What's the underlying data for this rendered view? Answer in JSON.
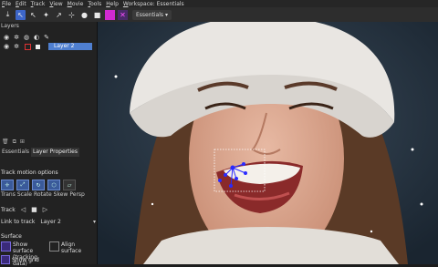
{
  "menu": [
    "File",
    "Edit",
    "Track",
    "View",
    "Movie",
    "Tools",
    "Help",
    "Workspace: Essentials"
  ],
  "toolbar": {
    "icons": [
      "save-icon",
      "arrow-icon",
      "select-icon",
      "wand-icon",
      "pointer-icon",
      "transform-icon",
      "circle-icon",
      "square-icon",
      "magenta-square-icon",
      "mask-x-icon"
    ],
    "workspace": "Essentials"
  },
  "layers": {
    "title": "Layers",
    "layer_name": "Layer 2",
    "footer_icons": [
      "trash-icon",
      "copy-icon",
      "add-icon"
    ]
  },
  "tabs": [
    "Essentials",
    "Layer Properties"
  ],
  "motion": {
    "title": "Track motion options",
    "options": [
      "Trans",
      "Scale",
      "Rotate",
      "Skew",
      "Persp"
    ]
  },
  "track": {
    "label": "Track"
  },
  "link": {
    "label": "Link to track",
    "value": "Layer 2"
  },
  "surface": {
    "title": "Surface",
    "show_surface": "Show surface (tracking data)",
    "align_surface": "Align surface",
    "show_grid": "Show grid"
  },
  "colors": {
    "accent": "#4f7fd0",
    "magenta": "#d02ad0",
    "tracker": "#2a2aff"
  }
}
